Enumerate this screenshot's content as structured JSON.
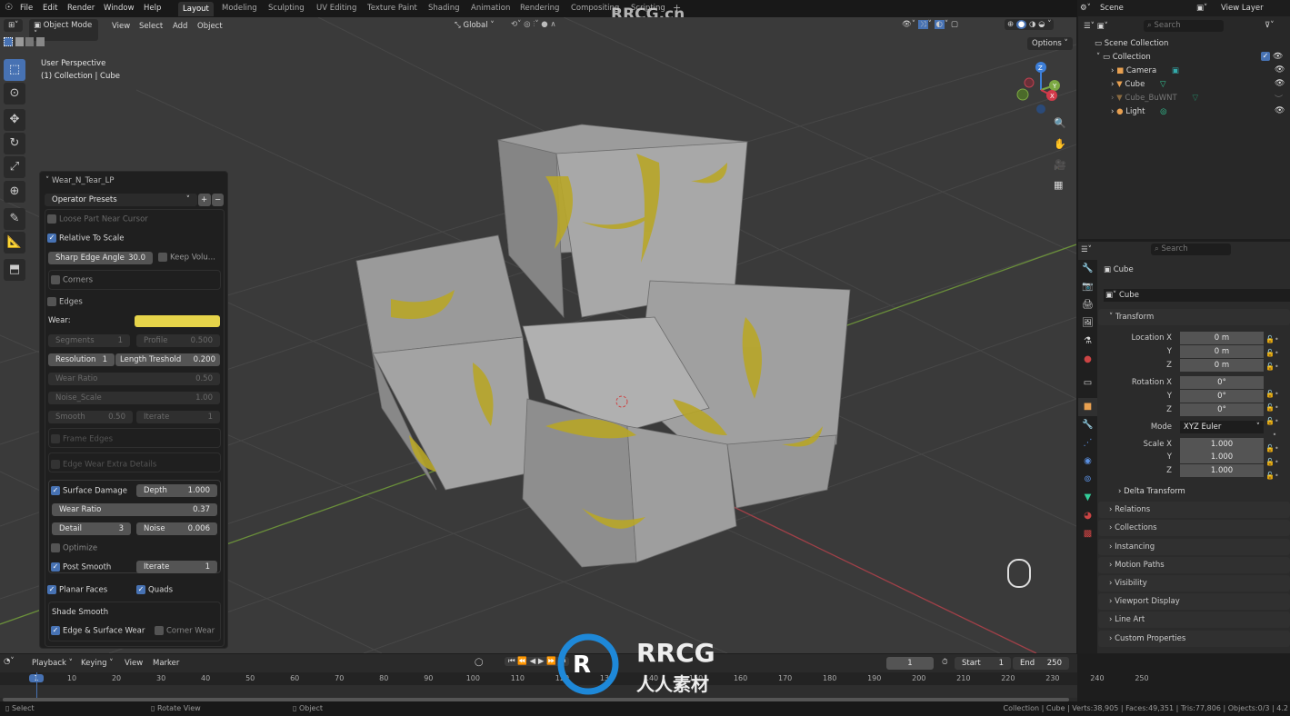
{
  "topbar": {
    "menus": [
      "File",
      "Edit",
      "Render",
      "Window",
      "Help"
    ],
    "workspaces": [
      "Layout",
      "Modeling",
      "Sculpting",
      "UV Editing",
      "Texture Paint",
      "Shading",
      "Animation",
      "Rendering",
      "Compositing",
      "Scripting"
    ],
    "active_workspace": "Layout",
    "add_tab": "+"
  },
  "viewport_header": {
    "mode": "Object Mode",
    "menus": [
      "View",
      "Select",
      "Add",
      "Object"
    ],
    "orientation": "Global",
    "options": "Options"
  },
  "viewport": {
    "perspective": "User Perspective",
    "context": "(1) Collection | Cube",
    "gizmo": {
      "z": "Z",
      "y": "Y",
      "x": "X"
    },
    "watermark": "RRCG.cn"
  },
  "operator_panel": {
    "title": "Wear_N_Tear_LP",
    "presets": "Operator Presets",
    "loose_part": "Loose Part Near Cursor",
    "loose_part_checked": false,
    "relative_scale": "Relative To Scale",
    "relative_scale_checked": true,
    "sharp_edge_label": "Sharp Edge Angle",
    "sharp_edge_value": "30.0",
    "keep_volume": "Keep Volu...",
    "keep_volume_checked": false,
    "corners": "Corners",
    "edges": "Edges",
    "wear_label": "Wear:",
    "wear_color": "#e6d44a",
    "segments_label": "Segments",
    "segments_value": "1",
    "profile_label": "Profile",
    "profile_value": "0.500",
    "resolution_label": "Resolution",
    "resolution_value": "1",
    "length_label": "Length Treshold",
    "length_value": "0.200",
    "wear_ratio_label": "Wear Ratio",
    "wear_ratio_value": "0.50",
    "noise_scale_label": "Noise_Scale",
    "noise_scale_value": "1.00",
    "smooth_label": "Smooth",
    "smooth_value": "0.50",
    "iterate_label": "Iterate",
    "iterate_value": "1",
    "frame_edges": "Frame Edges",
    "edge_wear_extra": "Edge Wear Extra Details",
    "surface_damage": "Surface Damage",
    "surface_damage_checked": true,
    "depth_label": "Depth",
    "depth_value": "1.000",
    "sd_wear_ratio_label": "Wear Ratio",
    "sd_wear_ratio_value": "0.37",
    "detail_label": "Detail",
    "detail_value": "3",
    "noise_label": "Noise",
    "noise_value": "0.006",
    "optimize": "Optimize",
    "post_smooth": "Post Smooth",
    "ps_iterate_label": "Iterate",
    "ps_iterate_value": "1",
    "planar_faces": "Planar Faces",
    "quads": "Quads",
    "shade_smooth": "Shade Smooth",
    "edge_surface_wear": "Edge & Surface Wear",
    "corner_wear": "Corner Wear"
  },
  "outliner": {
    "scene": "Scene",
    "view_layer": "View Layer",
    "search_placeholder": "Search",
    "scene_collection": "Scene Collection",
    "collection": "Collection",
    "items": [
      {
        "name": "Camera"
      },
      {
        "name": "Cube"
      },
      {
        "name": "Cube_BuWNT"
      },
      {
        "name": "Light"
      }
    ]
  },
  "properties": {
    "search_placeholder": "Search",
    "object": "Cube",
    "datablock": "Cube",
    "transform": "Transform",
    "location_label": "Location X",
    "rotation_label": "Rotation X",
    "scale_label": "Scale X",
    "axis_y": "Y",
    "axis_z": "Z",
    "location": [
      "0 m",
      "0 m",
      "0 m"
    ],
    "rotation": [
      "0°",
      "0°",
      "0°"
    ],
    "mode_label": "Mode",
    "mode": "XYZ Euler",
    "scale": [
      "1.000",
      "1.000",
      "1.000"
    ],
    "delta": "Delta Transform",
    "sections": [
      "Relations",
      "Collections",
      "Instancing",
      "Motion Paths",
      "Visibility",
      "Viewport Display",
      "Line Art",
      "Custom Properties"
    ]
  },
  "timeline": {
    "menus": [
      "Playback",
      "Keying",
      "View",
      "Marker"
    ],
    "current_frame": "1",
    "start_label": "Start",
    "start": "1",
    "end_label": "End",
    "end": "250",
    "ticks": [
      "1",
      "10",
      "20",
      "30",
      "40",
      "50",
      "60",
      "70",
      "80",
      "90",
      "100",
      "110",
      "120",
      "130",
      "140",
      "150",
      "160",
      "170",
      "180",
      "190",
      "200",
      "210",
      "220",
      "230",
      "240",
      "250"
    ]
  },
  "status": {
    "select": "Select",
    "rotate": "Rotate View",
    "object": "Object",
    "stats": "Collection | Cube | Verts:38,905 | Faces:49,351 | Tris:77,806 | Objects:0/3 | 4.2"
  },
  "watermark": {
    "text": "RRCG",
    "sub": "人人素材"
  }
}
